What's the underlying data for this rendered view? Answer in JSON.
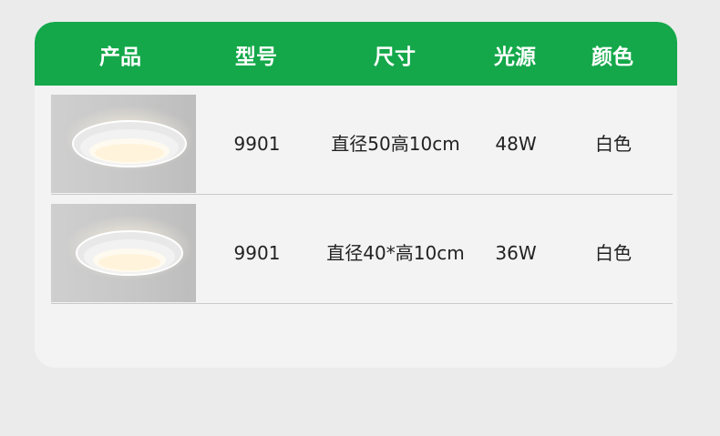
{
  "table": {
    "headers": [
      "产品",
      "型号",
      "尺寸",
      "光源",
      "颜色"
    ],
    "rows": [
      {
        "product_image": "ceiling-light-photo",
        "model": "9901",
        "size": "直径50高10cm",
        "light_source": "48W",
        "color": "白色"
      },
      {
        "product_image": "ceiling-light-photo",
        "model": "9901",
        "size": "直径40*高10cm",
        "light_source": "36W",
        "color": "白色"
      }
    ]
  },
  "colors": {
    "header_bg": "#14a84a",
    "header_text": "#ffffff",
    "card_bg": "#f3f3f3",
    "page_bg": "#ebebeb"
  }
}
